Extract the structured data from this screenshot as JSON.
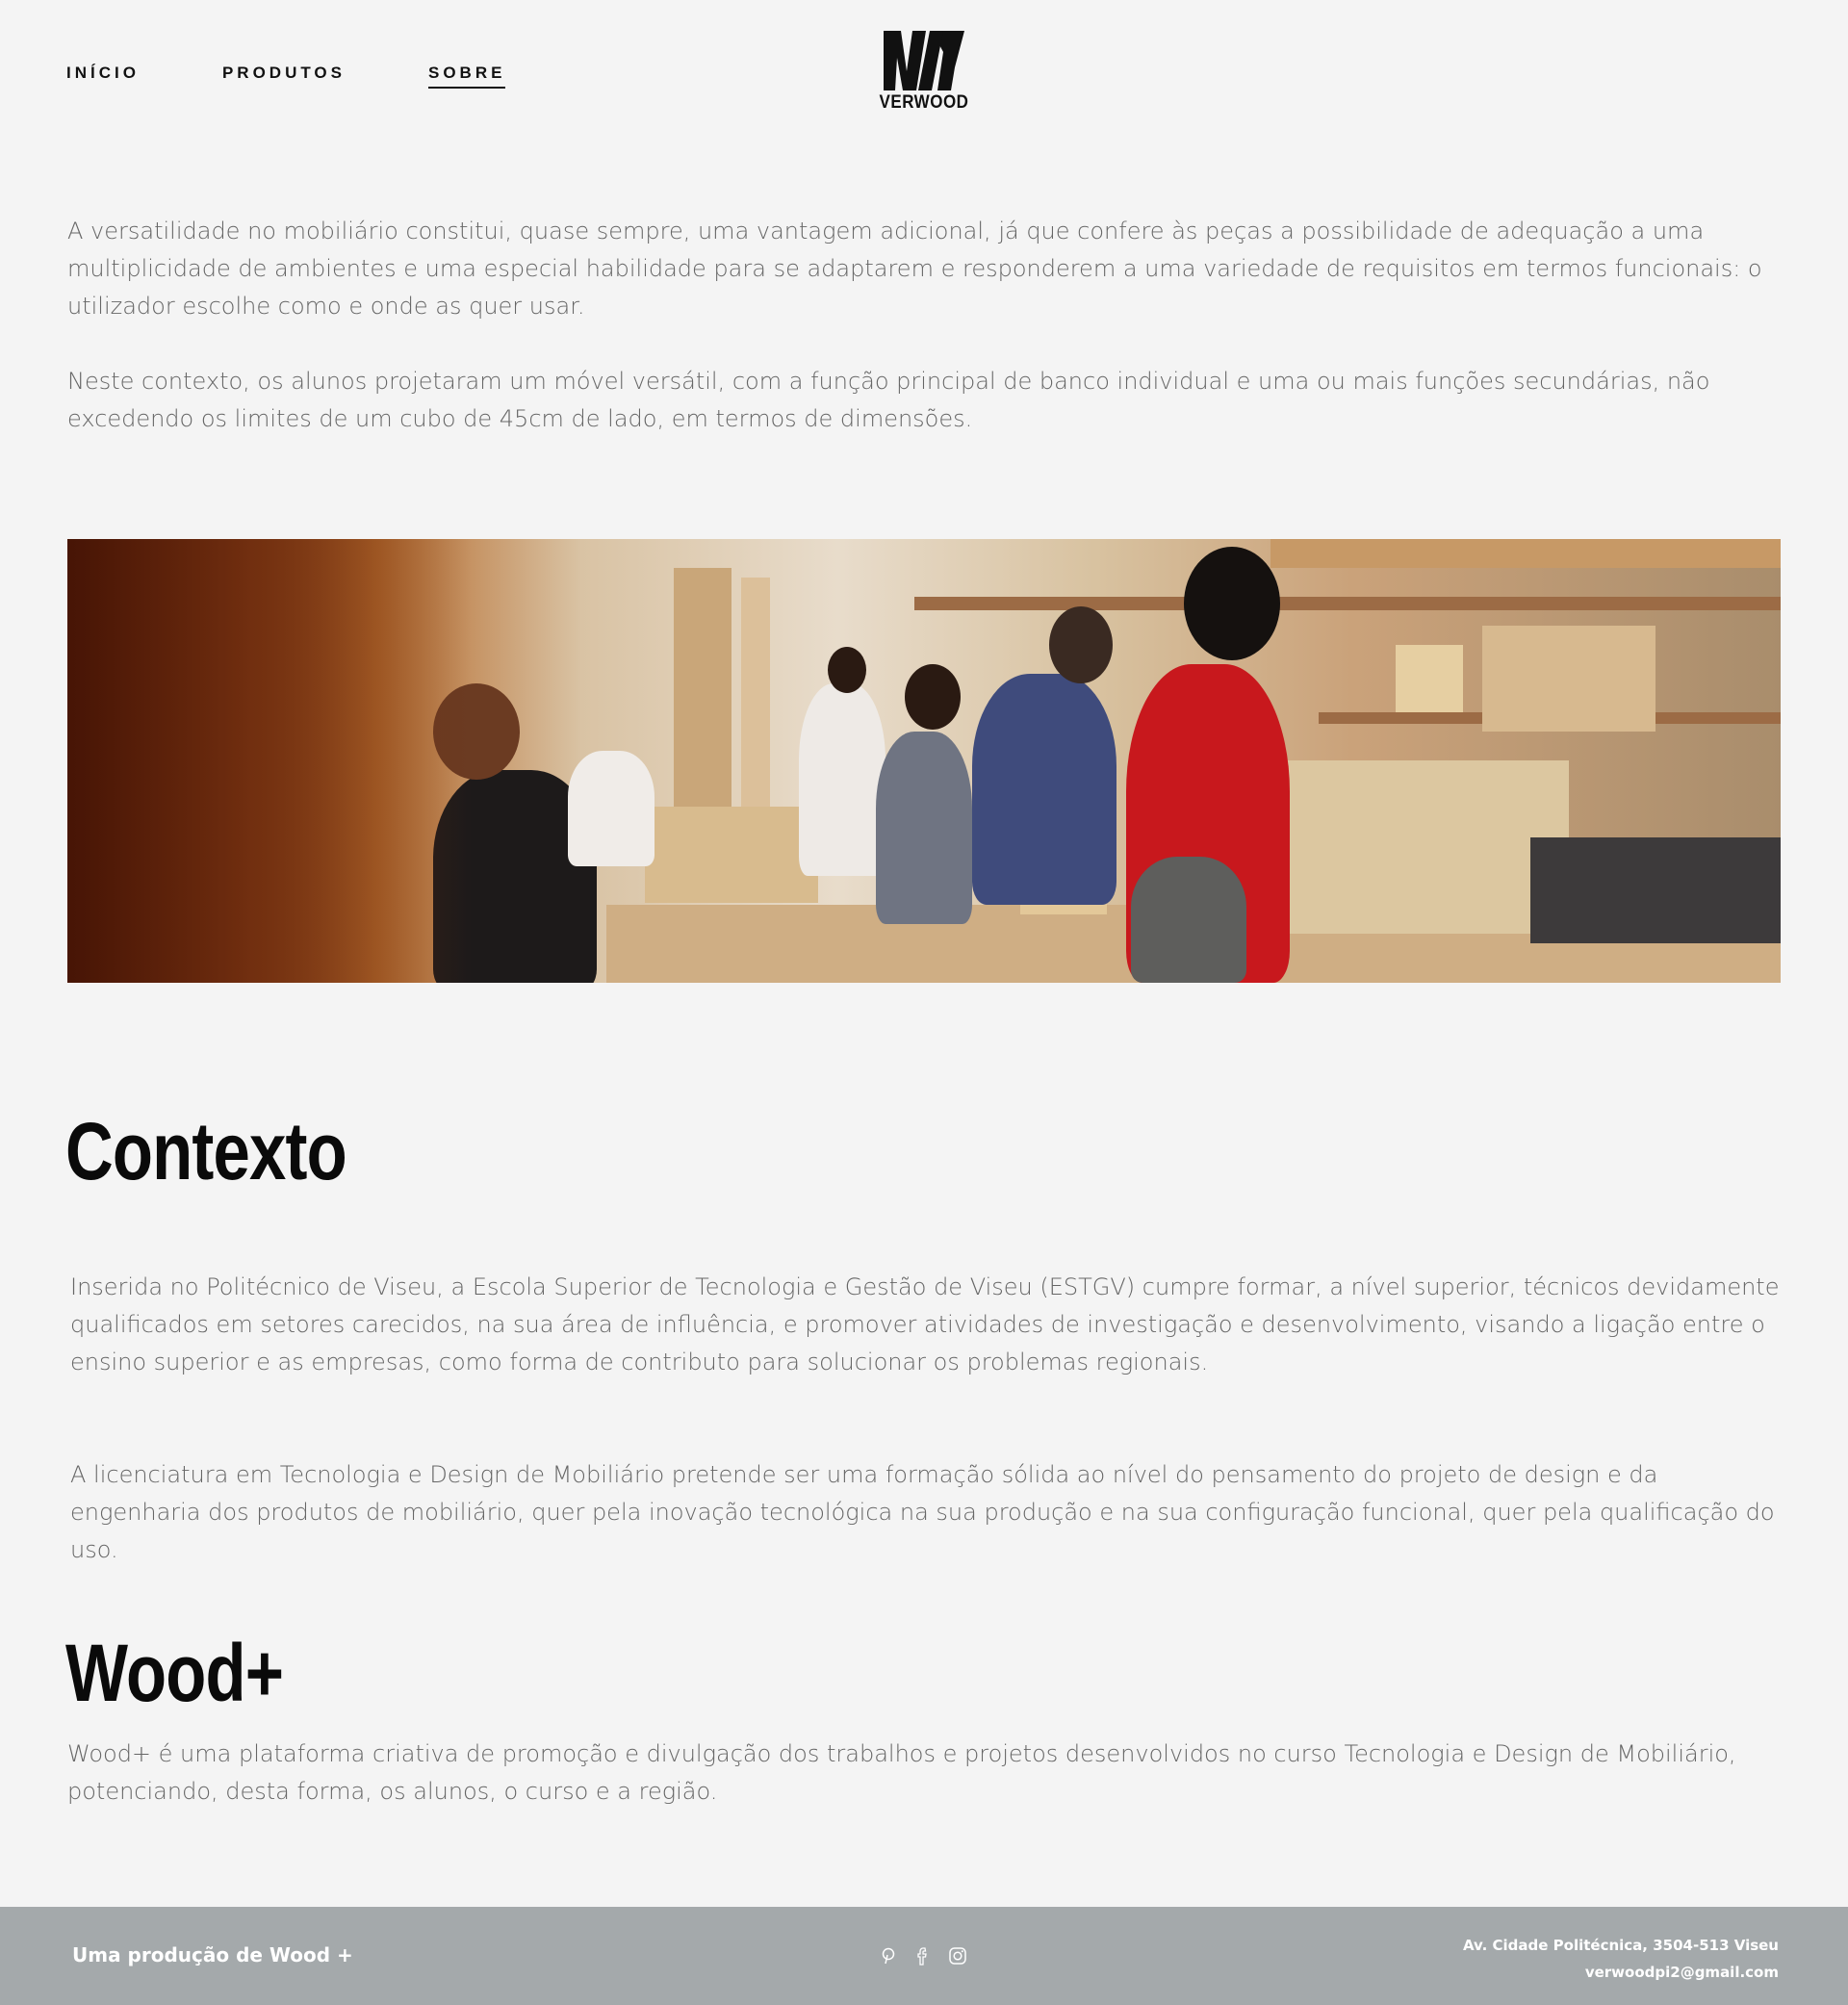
{
  "nav": {
    "items": [
      {
        "label": "INÍCIO",
        "active": false
      },
      {
        "label": "PRODUTOS",
        "active": false
      },
      {
        "label": "SOBRE",
        "active": true
      }
    ]
  },
  "logo": {
    "text": "VERWOOD"
  },
  "intro": {
    "paragraph_1": "A versatilidade no mobiliário constitui, quase sempre, uma vantagem adicional, já que confere às peças a possibilidade de adequação a uma multiplicidade de ambientes e uma especial habilidade para se adaptarem e responderem a uma variedade de requisitos em termos funcionais: o utilizador escolhe como e onde as quer usar.",
    "paragraph_2": "Neste contexto, os alunos projetaram um móvel versátil, com a função principal de banco individual e uma ou mais funções secundárias, não excedendo os limites de um cubo de 45cm de lado, em termos de dimensões."
  },
  "contexto": {
    "heading": "Contexto",
    "paragraph_1": "Inserida no Politécnico de Viseu, a Escola Superior de Tecnologia e Gestão de Viseu (ESTGV) cumpre formar, a nível superior, técnicos devidamente qualificados em setores carecidos, na sua área de influência, e promover atividades de investigação e desenvolvimento, visando a ligação entre o ensino superior e as empresas, como forma de contributo para solucionar os problemas regionais.",
    "paragraph_2": "A licenciatura em Tecnologia e Design de Mobiliário pretende ser uma formação sólida ao nível do pensamento do projeto de design e da engenharia dos produtos de mobiliário, quer pela inovação tecnológica na sua produção e na sua configuração funcional, quer pela qualificação do uso."
  },
  "wood": {
    "heading": "Wood+",
    "paragraph": "Wood+ é uma plataforma criativa de promoção e divulgação dos trabalhos e projetos desenvolvidos no curso Tecnologia e Design de Mobiliário, potenciando, desta forma, os alunos, o curso e a região."
  },
  "footer": {
    "credit": "Uma produção de Wood +",
    "address": "Av. Cidade Politécnica, 3504-513 Viseu",
    "email": "verwoodpi2@gmail.com",
    "socials": [
      "pinterest-icon",
      "facebook-icon",
      "instagram-icon"
    ]
  },
  "colors": {
    "background": "#f4f4f4",
    "footer": "#a4a9ab",
    "text": "#666666",
    "heading": "#0a0a0a"
  }
}
